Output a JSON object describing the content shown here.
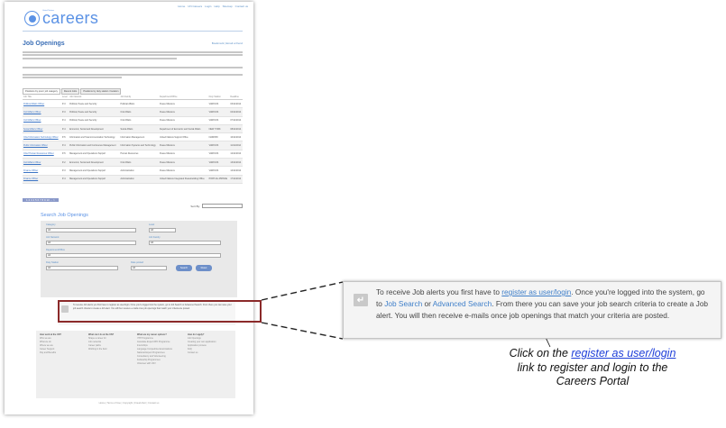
{
  "page": {
    "top_links": [
      "Home",
      "UN Careers",
      "Login",
      "Help",
      "Sitemap",
      "Contact us"
    ],
    "logo_org": "United Nations",
    "logo_text": "careers",
    "section_title": "Job Openings",
    "share_link": "Bookmark | Email a friend",
    "intro_lines": 6,
    "tabs": [
      "Positions by post / job category",
      "Recent Jobs",
      "Positions by duty station / location"
    ],
    "table_headers": [
      "Job Title",
      "Level",
      "Job Network",
      "Job Family",
      "Department/Office",
      "Duty Station",
      "Deadline"
    ],
    "jobs": [
      {
        "title": "Political Affairs Officer",
        "level": "P-3",
        "network": "Political, Peace and Security",
        "family": "Political Affairs",
        "dept": "Peace Missions",
        "station": "VARIOUS",
        "deadline": "03/11/2014"
      },
      {
        "title": "Civil Affairs Officer",
        "level": "P-3",
        "network": "Political, Peace and Security",
        "family": "Civil Affairs",
        "dept": "Peace Missions",
        "station": "VARIOUS",
        "deadline": "04/11/2014"
      },
      {
        "title": "Civil Affairs Officer",
        "level": "P-4",
        "network": "Political, Peace and Security",
        "family": "Civil Affairs",
        "dept": "Peace Missions",
        "station": "VARIOUS",
        "deadline": "07/11/2014"
      },
      {
        "title": "Social Affairs Officer",
        "level": "P-4",
        "network": "Economic, Social and Development",
        "family": "Social Affairs",
        "dept": "Department of Economic and Social Affairs",
        "station": "NEW YORK",
        "deadline": "08/11/2014"
      },
      {
        "title": "Chief Information Technology Officer",
        "level": "P-5",
        "network": "Information and Telecommunication Technology",
        "family": "Information Management",
        "dept": "United Nations Support Office",
        "station": "NAIROBI",
        "deadline": "10/11/2014"
      },
      {
        "title": "Public Information Officer",
        "level": "P-4",
        "network": "Public Information and Conference Management",
        "family": "Information Systems and Technology",
        "dept": "Peace Missions",
        "station": "VARIOUS",
        "deadline": "11/11/2014"
      },
      {
        "title": "Chief Human Resources Officer",
        "level": "P-5",
        "network": "Management and Operations Support",
        "family": "Human Resources",
        "dept": "Peace Missions",
        "station": "VARIOUS",
        "deadline": "12/11/2014"
      },
      {
        "title": "Civil Affairs Officer",
        "level": "P-2",
        "network": "Economic, Social and Development",
        "family": "Civil Affairs",
        "dept": "Peace Missions",
        "station": "VARIOUS",
        "deadline": "13/11/2014"
      },
      {
        "title": "Finance Officer",
        "level": "P-3",
        "network": "Management and Operations Support",
        "family": "Administration",
        "dept": "Peace Missions",
        "station": "VARIOUS",
        "deadline": "14/11/2014"
      },
      {
        "title": "Finance Officer",
        "level": "P-4",
        "network": "Management and Operations Support",
        "family": "Administration",
        "dept": "United Nations Integrated Peacebuilding Office",
        "station": "PORT-AU-PRINCE",
        "deadline": "17/11/2014"
      }
    ],
    "pager": "1 2 3 4 5 6 7 8 9 10 ... >",
    "sort_by": "Sort By:",
    "search_title": "Search Job Openings",
    "search_labels": [
      "Category",
      "Level",
      "Job Network",
      "Job Family",
      "Department/Office",
      "Duty Station",
      "Date posted"
    ],
    "search_buttons": [
      "Search",
      "Reset"
    ],
    "search_all": "All",
    "alert_text": "To receive Job alerts you first have to register as user/login. Once you're logged into the system, go to Job Search or Advanced Search. From there you can save your job search criteria to create a Job alert. You will then receive e-mails once job openings that match your criteria are posted.",
    "footer_cols": [
      {
        "head": "How work at the UN?",
        "items": [
          "Who we are",
          "What we do",
          "Where we are",
          "Career Support",
          "Pay and Benefits"
        ]
      },
      {
        "head": "What can I do at the UN?",
        "items": [
          "Shape a career for",
          "Job networks",
          "Career paths",
          "Working in the field"
        ]
      },
      {
        "head": "What are my career options?",
        "items": [
          "YPP Programme",
          "Associate Expert/JPO Programme",
          "Internships",
          "Language Competitive Examinations",
          "National Expert Programmes",
          "Consultancy and Volunteering",
          "Fellowship Programmes",
          "Volunteer with UNV"
        ]
      },
      {
        "head": "How do I apply?",
        "items": [
          "Job Openings",
          "Creating your own application",
          "Application process",
          "FAQ",
          "Contact us"
        ]
      }
    ],
    "copyright": "Home | Terms of Use | Copyright | Fraud Alert | Contact us"
  },
  "callout": {
    "text_before": "To receive Job alerts you first have to ",
    "link1": "register as user/login",
    "text_mid1": ". Once you're logged into the system, go to ",
    "link2": "Job Search",
    "text_mid2": " or ",
    "link3": "Advanced Search",
    "text_after": ". From there you can save your job search criteria to create a Job alert. You will then receive e-mails once job openings that match your criteria are posted."
  },
  "caption": {
    "before": "Click on the ",
    "link": "register as user/login",
    "after": " link to register and login to the Careers Portal"
  },
  "colors": {
    "highlight": "#8b2a2a",
    "brand": "#5b92e5",
    "link": "#1f3fd9"
  }
}
